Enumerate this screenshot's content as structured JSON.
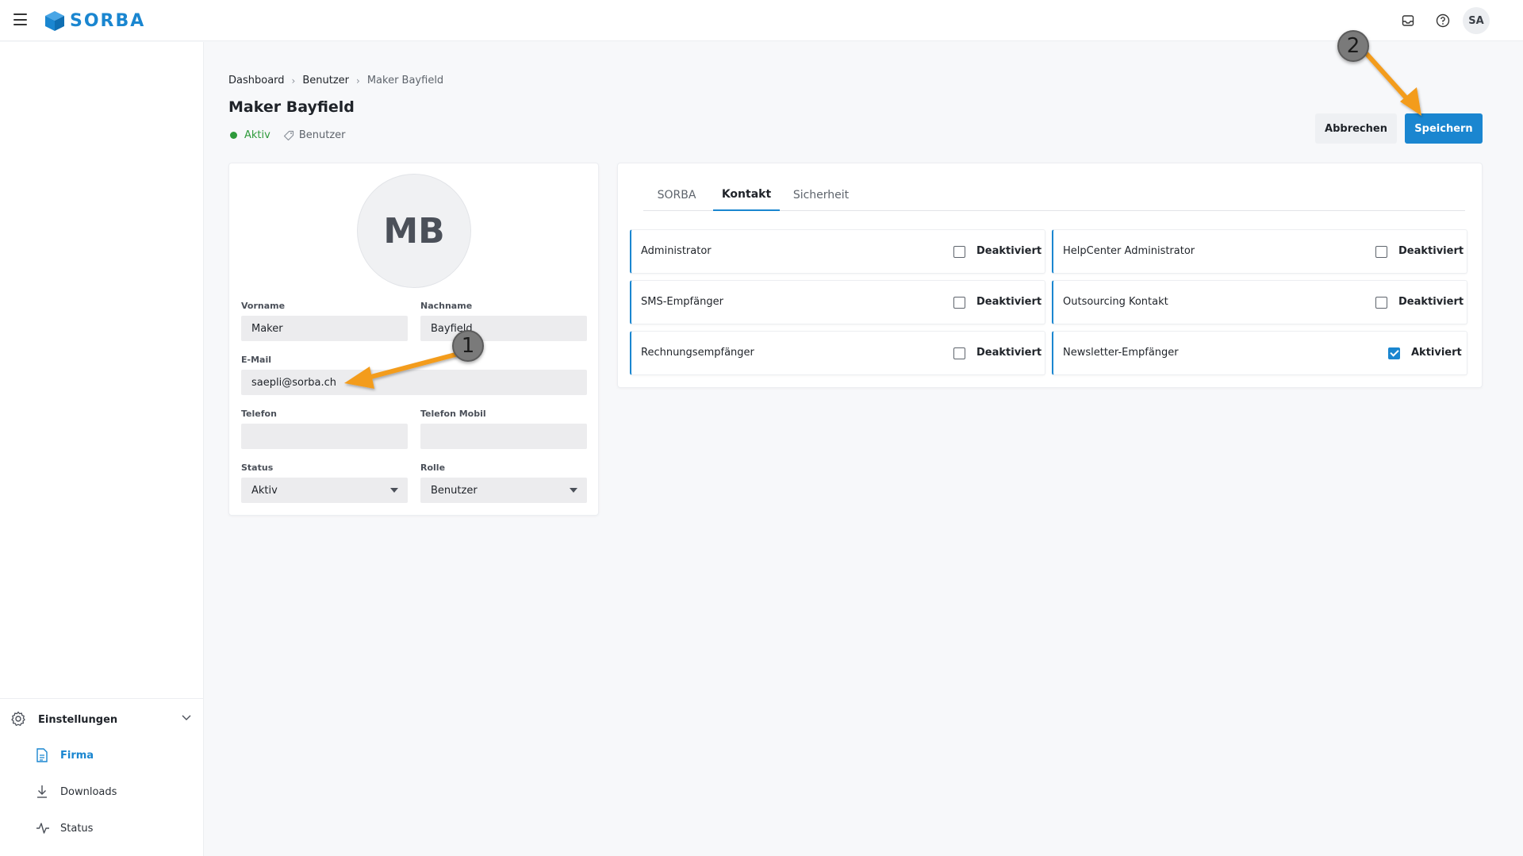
{
  "app": {
    "brand": "SORBA",
    "avatar_initials": "SA"
  },
  "breadcrumb": [
    "Dashboard",
    "Benutzer",
    "Maker Bayfield"
  ],
  "page": {
    "title": "Maker Bayfield",
    "status": "Aktiv",
    "role": "Benutzer"
  },
  "actions": {
    "cancel": "Abbrechen",
    "save": "Speichern"
  },
  "profile": {
    "initials": "MB",
    "fields": {
      "vorname_label": "Vorname",
      "vorname": "Maker",
      "nachname_label": "Nachname",
      "nachname": "Bayfield",
      "email_label": "E-Mail",
      "email": "saepli@sorba.ch",
      "telefon_label": "Telefon",
      "telefon": "",
      "mobil_label": "Telefon Mobil",
      "mobil": "",
      "status_label": "Status",
      "status": "Aktiv",
      "rolle_label": "Rolle",
      "rolle": "Benutzer"
    }
  },
  "tabs": [
    {
      "label": "SORBA",
      "active": false
    },
    {
      "label": "Kontakt",
      "active": true
    },
    {
      "label": "Sicherheit",
      "active": false
    }
  ],
  "permissions": [
    {
      "label": "Administrator",
      "state": "Deaktiviert",
      "checked": false
    },
    {
      "label": "HelpCenter Administrator",
      "state": "Deaktiviert",
      "checked": false
    },
    {
      "label": "SMS-Empfänger",
      "state": "Deaktiviert",
      "checked": false
    },
    {
      "label": "Outsourcing Kontakt",
      "state": "Deaktiviert",
      "checked": false
    },
    {
      "label": "Rechnungsempfänger",
      "state": "Deaktiviert",
      "checked": false
    },
    {
      "label": "Newsletter-Empfänger",
      "state": "Aktiviert",
      "checked": true
    }
  ],
  "sidebar": {
    "section": "Einstellungen",
    "items": [
      {
        "label": "Firma",
        "icon": "document-icon",
        "active": true
      },
      {
        "label": "Downloads",
        "icon": "download-icon",
        "active": false
      },
      {
        "label": "Status",
        "icon": "activity-icon",
        "active": false
      }
    ]
  },
  "annotations": [
    "1",
    "2"
  ],
  "colors": {
    "accent": "#1a86d0",
    "active_green": "#2e9a3b",
    "arrow": "#f39c1f"
  }
}
